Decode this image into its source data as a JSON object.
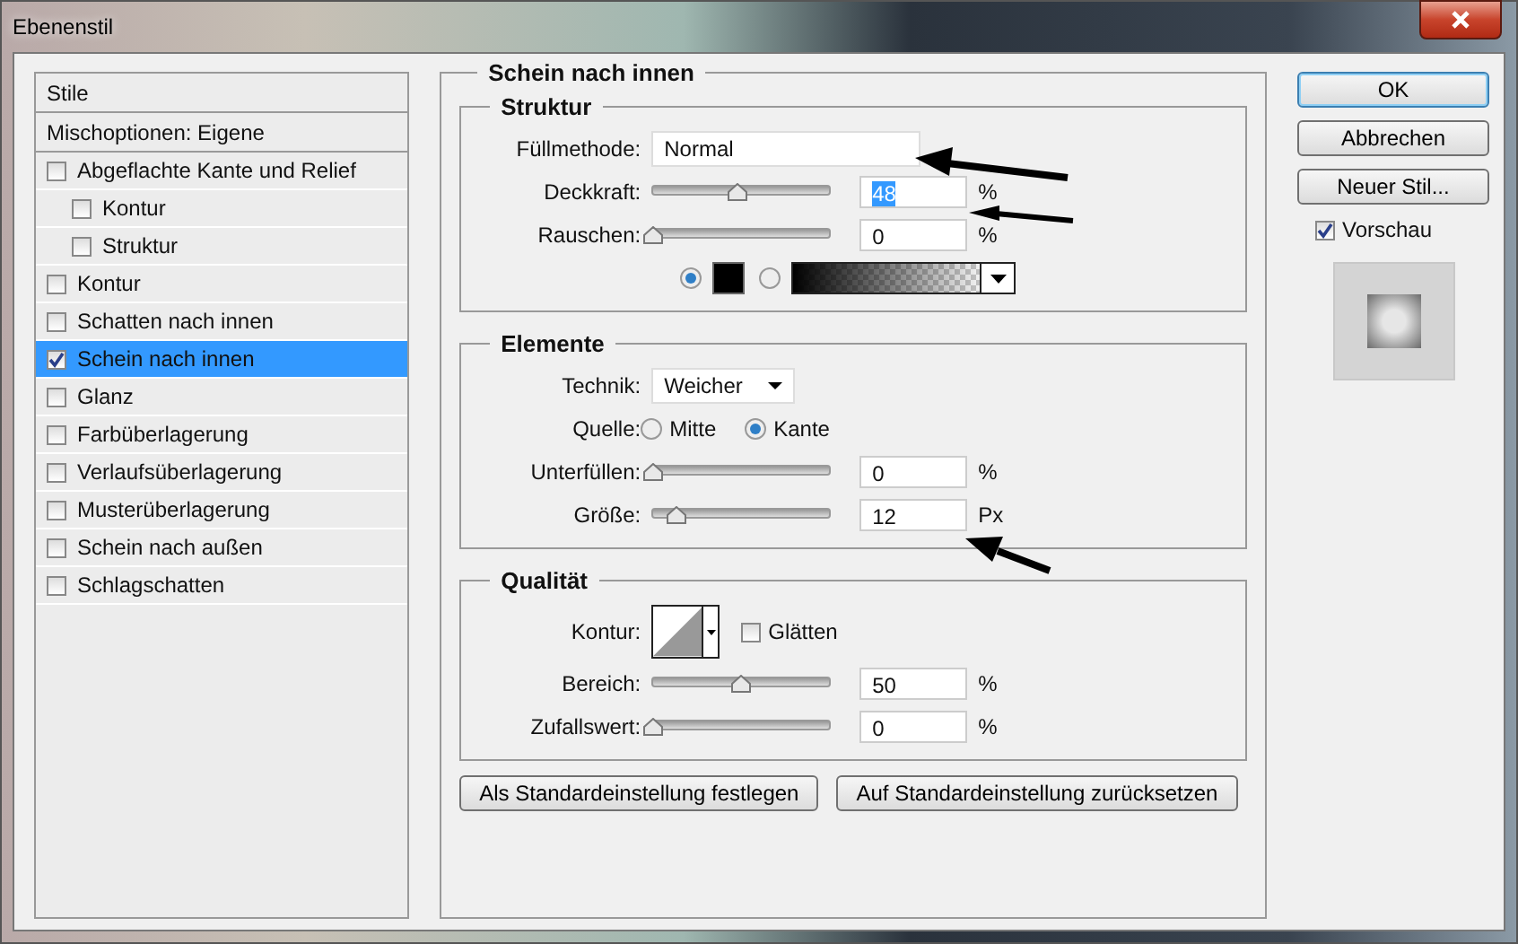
{
  "window": {
    "title": "Ebenenstil"
  },
  "styles_list": {
    "header": "Stile",
    "blend_options": "Mischoptionen: Eigene",
    "items": [
      {
        "label": "Abgeflachte Kante und Relief",
        "checked": false,
        "selected": false,
        "children": [
          {
            "label": "Kontur",
            "checked": false,
            "selected": false
          },
          {
            "label": "Struktur",
            "checked": false,
            "selected": false
          }
        ]
      },
      {
        "label": "Kontur",
        "checked": false,
        "selected": false
      },
      {
        "label": "Schatten nach innen",
        "checked": false,
        "selected": false
      },
      {
        "label": "Schein nach innen",
        "checked": true,
        "selected": true
      },
      {
        "label": "Glanz",
        "checked": false,
        "selected": false
      },
      {
        "label": "Farbüberlagerung",
        "checked": false,
        "selected": false
      },
      {
        "label": "Verlaufsüberlagerung",
        "checked": false,
        "selected": false
      },
      {
        "label": "Musterüberlagerung",
        "checked": false,
        "selected": false
      },
      {
        "label": "Schein nach außen",
        "checked": false,
        "selected": false
      },
      {
        "label": "Schlagschatten",
        "checked": false,
        "selected": false
      }
    ]
  },
  "panel": {
    "title": "Schein nach innen",
    "structure": {
      "title": "Struktur",
      "blend_mode": {
        "label": "Füllmethode:",
        "value": "Normal"
      },
      "sliders": [
        {
          "label": "Deckkraft:",
          "level": 0.48,
          "value": "48",
          "unit": "%",
          "text_selected": true
        },
        {
          "label": "Rauschen:",
          "level": 0,
          "value": "0",
          "unit": "%",
          "text_selected": false
        }
      ],
      "fill_options": [
        {
          "kind": "color",
          "selected": true
        },
        {
          "kind": "gradient",
          "selected": false
        }
      ]
    },
    "elements": {
      "title": "Elemente",
      "technique": {
        "label": "Technik:",
        "value": "Weicher"
      },
      "source": {
        "label": "Quelle:",
        "options": [
          {
            "label": "Mitte",
            "selected": false
          },
          {
            "label": "Kante",
            "selected": true
          }
        ]
      },
      "sliders": [
        {
          "label": "Unterfüllen:",
          "level": 0,
          "value": "0",
          "unit": "%",
          "text_selected": false
        },
        {
          "label": "Größe:",
          "level": 0.13,
          "value": "12",
          "unit": "Px",
          "text_selected": false
        }
      ]
    },
    "quality": {
      "title": "Qualität",
      "contour": {
        "label": "Kontur:"
      },
      "antialias": {
        "label": "Glätten",
        "checked": false
      },
      "sliders": [
        {
          "label": "Bereich:",
          "level": 0.5,
          "value": "50",
          "unit": "%",
          "text_selected": false
        },
        {
          "label": "Zufallswert:",
          "level": 0,
          "value": "0",
          "unit": "%",
          "text_selected": false
        }
      ]
    },
    "default_buttons": [
      "Als Standardeinstellung festlegen",
      "Auf Standardeinstellung zurücksetzen"
    ]
  },
  "buttons": [
    {
      "label": "OK",
      "default": true
    },
    {
      "label": "Abbrechen",
      "default": false
    },
    {
      "label": "Neuer Stil...",
      "default": false
    }
  ],
  "preview": {
    "label": "Vorschau",
    "checked": true
  }
}
